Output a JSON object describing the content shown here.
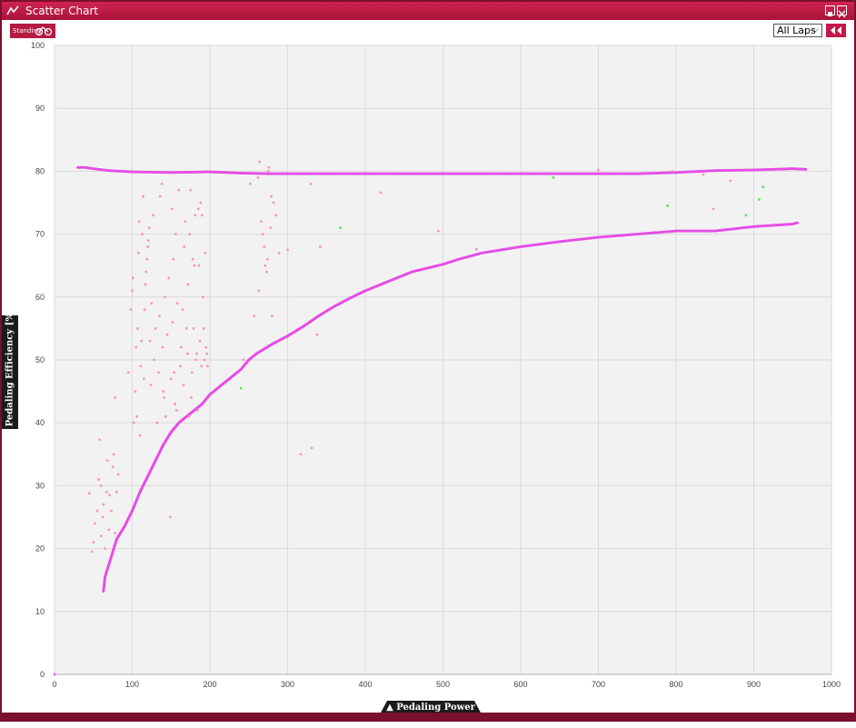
{
  "window": {
    "title": "Scatter Chart"
  },
  "toolbar": {
    "standing_label": "Standing",
    "laps_filter": "All Laps"
  },
  "colors": {
    "accent": "#c5174a",
    "series_main": "#e64ce6",
    "series_points": "#f28cb4",
    "series_green": "#4cd94c",
    "plot_bg": "#f2f2f2",
    "grid": "#dadada"
  },
  "icons": {
    "app": "app-icon",
    "restore": "restore-icon",
    "close": "close-icon",
    "collapse": "double-chevron-left-icon"
  },
  "chart_data": {
    "type": "scatter",
    "xlabel": "▲ Pedaling Power [W]",
    "ylabel": "▼ Pedaling Efficiency [%]",
    "xlim": [
      0,
      1000
    ],
    "ylim": [
      0,
      100
    ],
    "xticks": [
      0,
      100,
      200,
      300,
      400,
      500,
      600,
      700,
      800,
      900,
      1000
    ],
    "yticks": [
      0,
      10,
      20,
      30,
      40,
      50,
      60,
      70,
      80,
      90,
      100
    ],
    "grid": true,
    "series": [
      {
        "color": "#e64ce6",
        "style": "dense",
        "points": [
          [
            30,
            80.6
          ],
          [
            40,
            80.6
          ],
          [
            50,
            80.4
          ],
          [
            70,
            80.1
          ],
          [
            100,
            79.9
          ],
          [
            150,
            79.8
          ],
          [
            200,
            79.9
          ],
          [
            240,
            79.7
          ],
          [
            280,
            79.6
          ],
          [
            350,
            79.6
          ],
          [
            400,
            79.6
          ],
          [
            450,
            79.6
          ],
          [
            500,
            79.6
          ],
          [
            550,
            79.6
          ],
          [
            600,
            79.6
          ],
          [
            650,
            79.6
          ],
          [
            700,
            79.6
          ],
          [
            750,
            79.6
          ],
          [
            800,
            79.8
          ],
          [
            850,
            80.1
          ],
          [
            900,
            80.2
          ],
          [
            950,
            80.4
          ],
          [
            967,
            80.3
          ]
        ]
      },
      {
        "color": "#e64ce6",
        "style": "dense",
        "points": [
          [
            63,
            13.2
          ],
          [
            65,
            15.5
          ],
          [
            70,
            17.5
          ],
          [
            75,
            19.5
          ],
          [
            80,
            21.5
          ],
          [
            90,
            23.5
          ],
          [
            100,
            26
          ],
          [
            110,
            29
          ],
          [
            120,
            31.5
          ],
          [
            130,
            34
          ],
          [
            140,
            36.5
          ],
          [
            150,
            38.5
          ],
          [
            160,
            40
          ],
          [
            170,
            41
          ],
          [
            180,
            42
          ],
          [
            190,
            43
          ],
          [
            200,
            44.5
          ],
          [
            220,
            46.5
          ],
          [
            240,
            48.5
          ],
          [
            250,
            50
          ],
          [
            260,
            51
          ],
          [
            280,
            52.5
          ],
          [
            300,
            53.8
          ],
          [
            320,
            55.3
          ],
          [
            340,
            57
          ],
          [
            360,
            58.5
          ],
          [
            380,
            59.8
          ],
          [
            400,
            61
          ],
          [
            420,
            62
          ],
          [
            440,
            63
          ],
          [
            460,
            64
          ],
          [
            480,
            64.6
          ],
          [
            500,
            65.2
          ],
          [
            520,
            66
          ],
          [
            550,
            67
          ],
          [
            580,
            67.6
          ],
          [
            600,
            68
          ],
          [
            650,
            68.8
          ],
          [
            700,
            69.5
          ],
          [
            750,
            70
          ],
          [
            800,
            70.5
          ],
          [
            850,
            70.5
          ],
          [
            900,
            71.2
          ],
          [
            950,
            71.6
          ],
          [
            956,
            71.8
          ]
        ]
      },
      {
        "color": "#f28cb4",
        "style": "scatter",
        "points": [
          [
            45,
            28.8
          ],
          [
            48,
            19.5
          ],
          [
            50,
            21
          ],
          [
            52,
            24
          ],
          [
            55,
            26
          ],
          [
            57,
            31
          ],
          [
            58,
            37.3
          ],
          [
            60,
            30
          ],
          [
            60,
            22
          ],
          [
            62,
            25
          ],
          [
            63,
            27
          ],
          [
            65,
            20
          ],
          [
            67,
            29
          ],
          [
            68,
            34
          ],
          [
            70,
            23
          ],
          [
            71,
            28.5
          ],
          [
            73,
            26
          ],
          [
            75,
            33
          ],
          [
            76,
            35
          ],
          [
            78,
            22.5
          ],
          [
            80,
            29
          ],
          [
            82,
            31.8
          ],
          [
            78,
            44
          ],
          [
            95,
            48
          ],
          [
            98,
            58
          ],
          [
            100,
            61
          ],
          [
            101,
            63
          ],
          [
            102,
            40
          ],
          [
            104,
            45
          ],
          [
            105,
            52
          ],
          [
            106,
            41
          ],
          [
            107,
            55
          ],
          [
            108,
            67
          ],
          [
            109,
            72
          ],
          [
            110,
            38
          ],
          [
            111,
            49
          ],
          [
            112,
            53
          ],
          [
            113,
            70
          ],
          [
            114,
            76
          ],
          [
            115,
            47
          ],
          [
            116,
            58
          ],
          [
            117,
            62
          ],
          [
            118,
            64
          ],
          [
            119,
            66
          ],
          [
            120,
            68
          ],
          [
            121,
            69
          ],
          [
            122,
            71
          ],
          [
            123,
            53
          ],
          [
            124,
            46
          ],
          [
            125,
            59
          ],
          [
            127,
            73
          ],
          [
            128,
            50
          ],
          [
            130,
            55
          ],
          [
            132,
            40
          ],
          [
            134,
            48
          ],
          [
            135,
            57
          ],
          [
            136,
            76
          ],
          [
            138,
            78
          ],
          [
            139,
            52
          ],
          [
            140,
            45
          ],
          [
            141,
            44
          ],
          [
            142,
            60
          ],
          [
            143,
            41
          ],
          [
            145,
            54
          ],
          [
            147,
            63
          ],
          [
            149,
            25
          ],
          [
            150,
            47
          ],
          [
            151,
            74
          ],
          [
            152,
            56
          ],
          [
            153,
            66
          ],
          [
            154,
            48
          ],
          [
            155,
            43
          ],
          [
            156,
            70
          ],
          [
            157,
            42
          ],
          [
            158,
            59
          ],
          [
            160,
            77
          ],
          [
            162,
            49
          ],
          [
            163,
            52
          ],
          [
            165,
            58
          ],
          [
            166,
            46
          ],
          [
            167,
            68
          ],
          [
            168,
            72
          ],
          [
            170,
            55
          ],
          [
            171,
            51
          ],
          [
            172,
            62
          ],
          [
            173,
            41
          ],
          [
            174,
            70
          ],
          [
            175,
            77
          ],
          [
            176,
            44
          ],
          [
            177,
            48
          ],
          [
            178,
            66
          ],
          [
            179,
            55
          ],
          [
            180,
            65
          ],
          [
            181,
            73
          ],
          [
            182,
            50
          ],
          [
            183,
            51
          ],
          [
            184,
            42
          ],
          [
            185,
            74
          ],
          [
            186,
            65
          ],
          [
            187,
            53
          ],
          [
            188,
            75
          ],
          [
            189,
            49
          ],
          [
            190,
            73
          ],
          [
            191,
            60
          ],
          [
            192,
            55
          ],
          [
            193,
            50
          ],
          [
            194,
            67
          ],
          [
            195,
            52
          ],
          [
            196,
            51
          ],
          [
            197,
            49
          ],
          [
            243,
            50
          ],
          [
            252,
            78
          ],
          [
            257,
            57
          ],
          [
            262,
            79
          ],
          [
            263,
            61
          ],
          [
            264,
            81.5
          ],
          [
            266,
            72
          ],
          [
            268,
            70
          ],
          [
            270,
            68
          ],
          [
            271,
            65
          ],
          [
            273,
            64
          ],
          [
            274,
            66
          ],
          [
            275,
            80
          ],
          [
            276,
            80.6
          ],
          [
            278,
            71
          ],
          [
            279,
            76
          ],
          [
            280,
            57
          ],
          [
            282,
            75
          ],
          [
            285,
            73
          ],
          [
            289,
            67
          ],
          [
            300,
            67.5
          ],
          [
            317,
            35
          ],
          [
            331,
            36
          ],
          [
            330,
            78
          ],
          [
            338,
            54
          ],
          [
            342,
            68
          ],
          [
            420,
            76.6
          ],
          [
            494,
            70.5
          ],
          [
            543,
            67.6
          ],
          [
            700,
            80.2
          ],
          [
            795,
            80
          ],
          [
            835,
            79.5
          ],
          [
            848,
            74
          ],
          [
            870,
            78.5
          ]
        ]
      },
      {
        "color": "#4cd94c",
        "style": "scatter",
        "points": [
          [
            240,
            45.5
          ],
          [
            368,
            71
          ],
          [
            642,
            79
          ],
          [
            789,
            74.5
          ],
          [
            890,
            73
          ],
          [
            907,
            75.5
          ],
          [
            912,
            77.5
          ]
        ]
      },
      {
        "color": "#e64ce6",
        "style": "scatter",
        "points": [
          [
            0,
            0
          ]
        ]
      }
    ]
  }
}
